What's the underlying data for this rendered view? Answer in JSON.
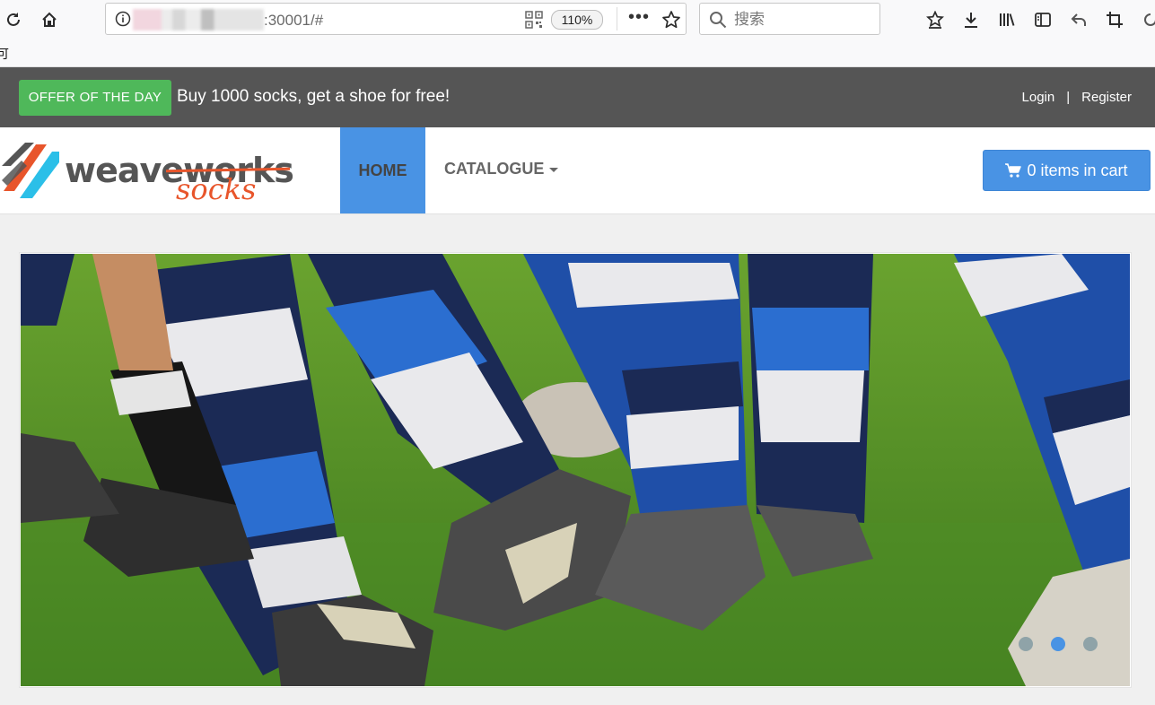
{
  "browser": {
    "url_suffix": ":30001/#",
    "zoom": "110%",
    "more_label": "•••",
    "search_placeholder": "搜索",
    "bookmark_fragment": "可"
  },
  "offer": {
    "badge": "OFFER OF THE DAY",
    "text": "Buy 1000 socks, get a shoe for free!"
  },
  "auth": {
    "login": "Login",
    "separator": "|",
    "register": "Register"
  },
  "logo": {
    "word1": "weaveworks",
    "word2": "socks"
  },
  "nav": {
    "home": "HOME",
    "catalogue": "CATALOGUE"
  },
  "cart": {
    "label": "0 items in cart"
  },
  "carousel": {
    "active_index": 1,
    "dots": [
      {
        "state": "inactive",
        "color": "#8fa3a8"
      },
      {
        "state": "active",
        "color": "#4993e4"
      },
      {
        "state": "inactive",
        "color": "#8fa3a8"
      }
    ]
  },
  "colors": {
    "offer_bg": "#555555",
    "offer_badge": "#4fb85a",
    "accent_blue": "#4993e4",
    "logo_orange": "#e8552b"
  }
}
